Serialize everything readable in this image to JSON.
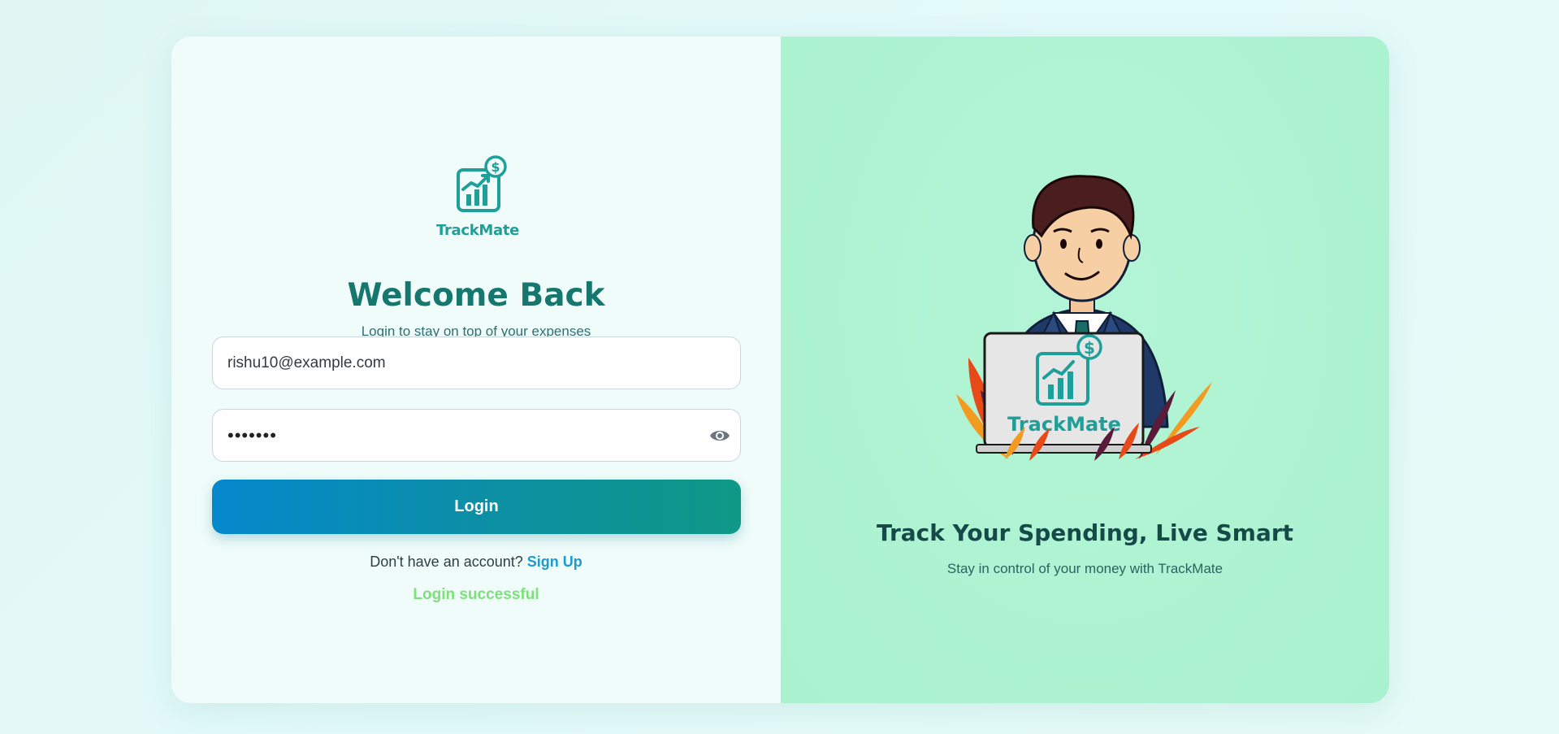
{
  "brand": {
    "name": "TrackMate",
    "accent": "#1e9f9a",
    "logo_icon": "chart-dollar-icon"
  },
  "login": {
    "title": "Welcome Back",
    "subtitle": "Login to stay on top of your expenses",
    "email_value": "rishu10@example.com",
    "password_value": "1234567",
    "password_toggle_icon": "eye-icon",
    "button_label": "Login",
    "signup_prompt": "Don't have an account?",
    "signup_link": "Sign Up",
    "status_message": "Login successful",
    "status_color": "#7ee07c"
  },
  "promo": {
    "heading": "Track Your Spending, Live Smart",
    "subheading": "Stay in control of your money with TrackMate",
    "illustration": "businessman-with-laptop-illustration",
    "laptop_label": "TrackMate"
  }
}
